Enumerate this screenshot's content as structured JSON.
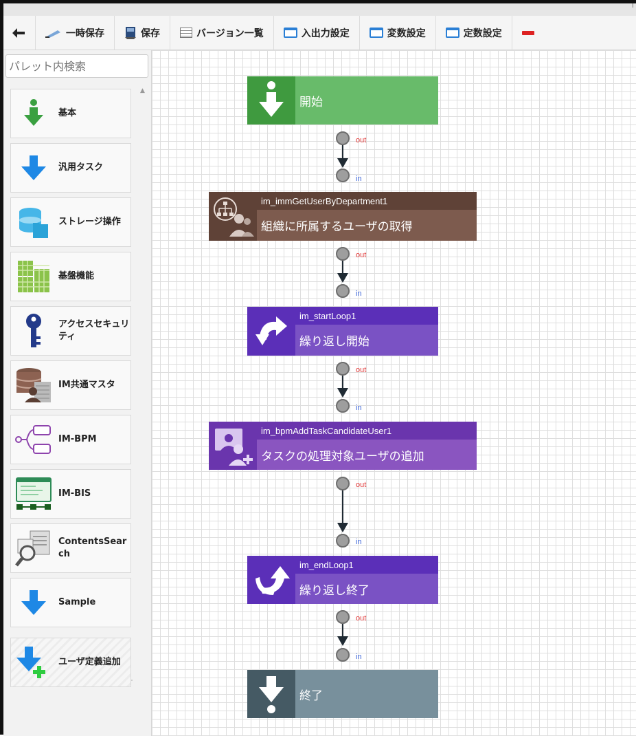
{
  "toolbar": {
    "back_label": "",
    "temp_save": "一時保存",
    "save": "保存",
    "versions": "バージョン一覧",
    "io_settings": "入出力設定",
    "var_settings": "変数設定",
    "const_settings": "定数設定"
  },
  "palette": {
    "search_placeholder": "パレット内検索",
    "items": [
      {
        "label": "基本",
        "icon": "down-arrow-green-icon"
      },
      {
        "label": "汎用タスク",
        "icon": "down-arrow-blue-icon"
      },
      {
        "label": "ストレージ操作",
        "icon": "storage-icon"
      },
      {
        "label": "基盤機能",
        "icon": "grid-blocks-icon"
      },
      {
        "label": "アクセスセキュリティ",
        "icon": "key-icon"
      },
      {
        "label": "IM共通マスタ",
        "icon": "database-user-icon"
      },
      {
        "label": "IM-BPM",
        "icon": "bpm-flow-icon"
      },
      {
        "label": "IM-BIS",
        "icon": "bis-window-icon"
      },
      {
        "label": "ContentsSearch",
        "icon": "search-document-icon"
      },
      {
        "label": "Sample",
        "icon": "down-arrow-blue-icon"
      },
      {
        "label": "ユーザ定義追加",
        "icon": "add-user-defined-icon"
      }
    ]
  },
  "flow": {
    "port_out": "out",
    "port_in": "in",
    "nodes": [
      {
        "id": "",
        "name": "開始",
        "kind": "start"
      },
      {
        "id": "im_immGetUserByDepartment1",
        "name": "組織に所属するユーザの取得",
        "kind": "org"
      },
      {
        "id": "im_startLoop1",
        "name": "繰り返し開始",
        "kind": "loop-start"
      },
      {
        "id": "im_bpmAddTaskCandidateUser1",
        "name": "タスクの処理対象ユーザの追加",
        "kind": "bpm"
      },
      {
        "id": "im_endLoop1",
        "name": "繰り返し終了",
        "kind": "loop-end"
      },
      {
        "id": "",
        "name": "終了",
        "kind": "end"
      }
    ]
  },
  "colors": {
    "start_dark": "#3f9a3f",
    "start_light": "#68bb6a",
    "org_dark": "#5f4237",
    "org_light": "#7d5b4e",
    "loop_dark": "#5b2fb8",
    "loop_light": "#7a52c4",
    "bpm_dark": "#6a35ad",
    "bpm_light": "#8a55c0",
    "end_dark": "#455a64",
    "end_light": "#78909c"
  }
}
